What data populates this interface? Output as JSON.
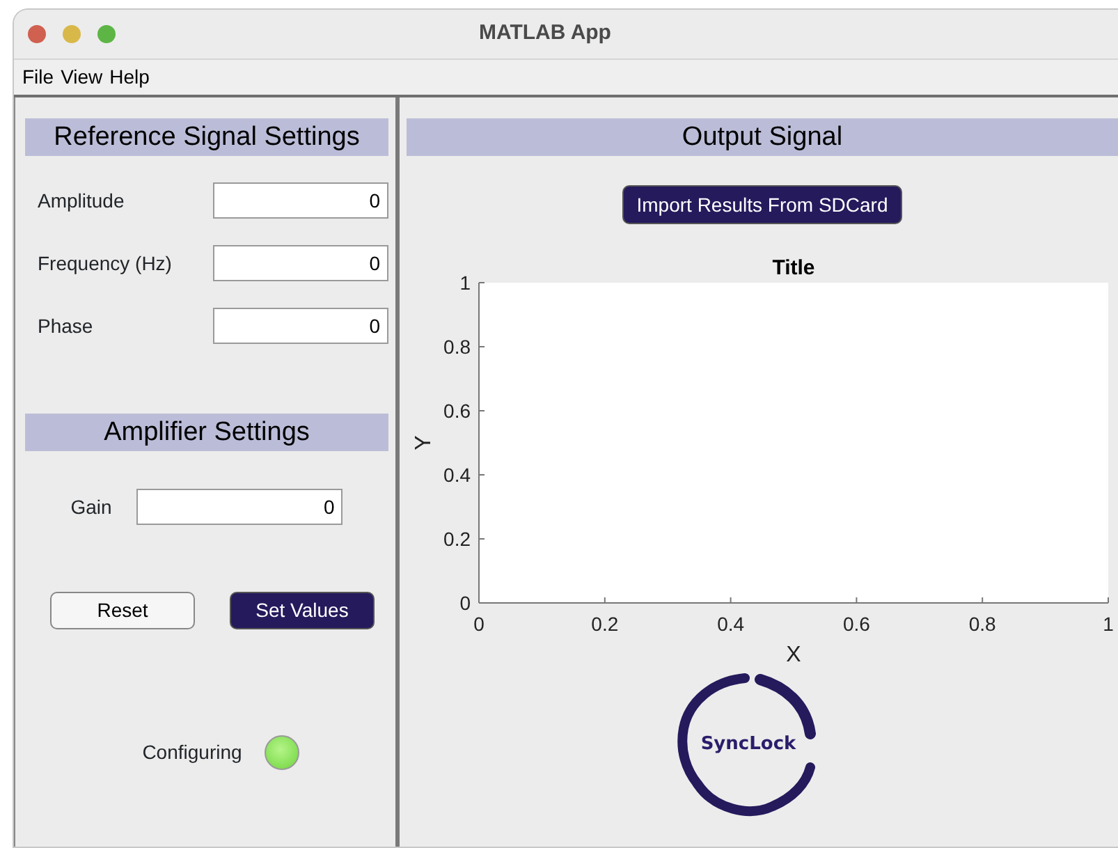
{
  "window": {
    "title": "MATLAB App"
  },
  "menu": [
    "File",
    "View",
    "Help"
  ],
  "reference_settings": {
    "heading": "Reference Signal Settings",
    "fields": [
      {
        "label": "Amplitude",
        "value": "0"
      },
      {
        "label": "Frequency (Hz)",
        "value": "0"
      },
      {
        "label": "Phase",
        "value": "0"
      }
    ]
  },
  "amplifier_settings": {
    "heading": "Amplifier Settings",
    "fields": [
      {
        "label": "Gain",
        "value": "0"
      }
    ]
  },
  "buttons": [
    {
      "label": "Reset",
      "kind": "plain"
    },
    {
      "label": "Set Values",
      "kind": "primary"
    }
  ],
  "status": {
    "label": "Configuring",
    "on": true
  },
  "output": {
    "heading": "Output Signal",
    "button": "Import Results From SDCard",
    "chart_data": {
      "type": "line",
      "title": "Title",
      "xlabel": "X",
      "ylabel": "Y",
      "xlim": [
        0,
        1
      ],
      "ylim": [
        0,
        1
      ],
      "xticks": [
        0,
        0.2,
        0.4,
        0.6,
        0.8,
        1
      ],
      "yticks": [
        0,
        0.2,
        0.4,
        0.6,
        0.8,
        1
      ]
    },
    "logo": {
      "text": "SyncLock"
    }
  }
}
